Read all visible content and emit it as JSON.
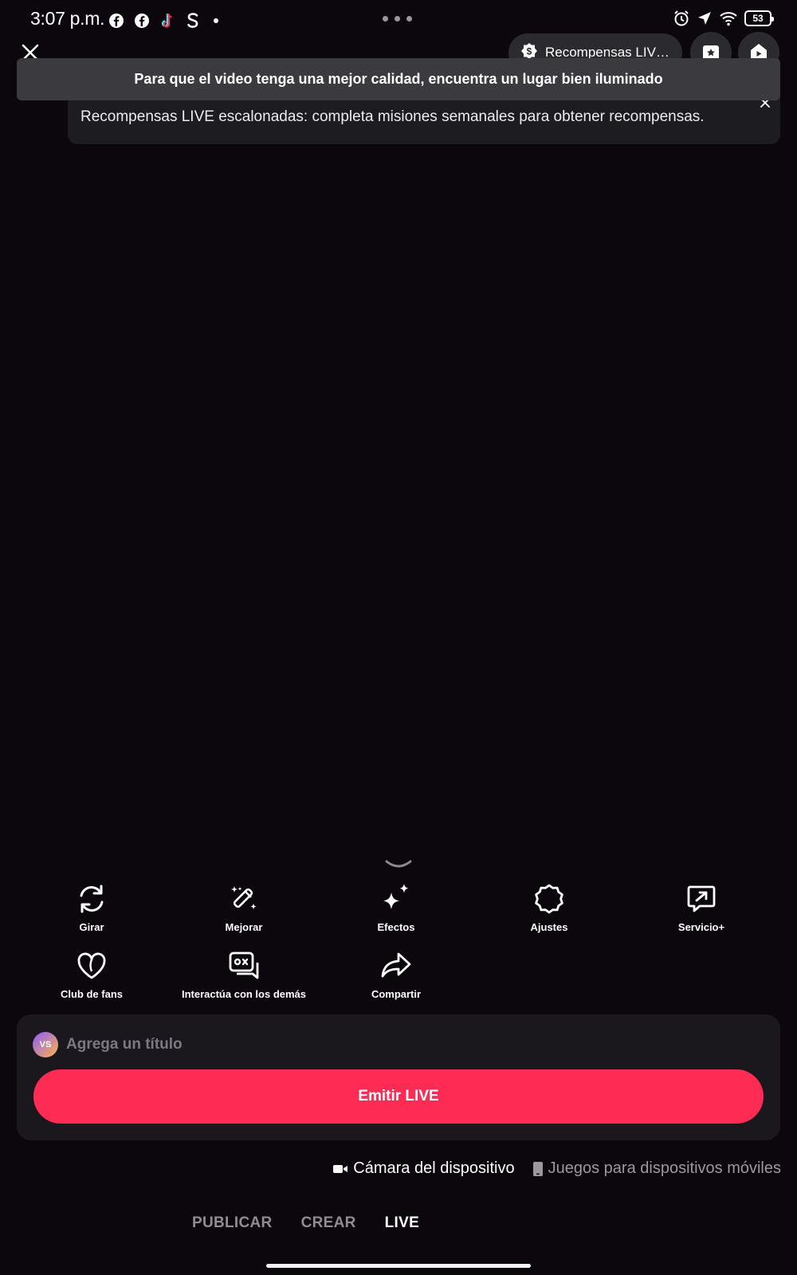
{
  "status_bar": {
    "time": "3:07 p.m.",
    "notification_icons": [
      "facebook-icon",
      "facebook-icon",
      "tiktok-icon",
      "s-app-icon"
    ],
    "battery": "53"
  },
  "top_bar": {
    "rewards_label": "Recompensas LIVE..."
  },
  "toast": {
    "message": "Para que el video tenga una mejor calidad, encuentra un lugar bien iluminado"
  },
  "tip": {
    "message": "Recompensas LIVE escalonadas: completa misiones semanales para obtener recompensas."
  },
  "tools": [
    {
      "label": "Girar",
      "icon": "rotate-icon"
    },
    {
      "label": "Mejorar",
      "icon": "magic-wand-icon"
    },
    {
      "label": "Efectos",
      "icon": "sparkles-icon"
    },
    {
      "label": "Ajustes",
      "icon": "settings-icon"
    },
    {
      "label": "Servicio+",
      "icon": "service-icon"
    },
    {
      "label": "Club de fans",
      "icon": "heart-icon"
    },
    {
      "label": "Interactúa con los demás",
      "icon": "interact-icon"
    },
    {
      "label": "Compartir",
      "icon": "share-icon"
    }
  ],
  "panel": {
    "avatar_text": "VS",
    "title_placeholder": "Agrega un título",
    "go_live_label": "Emitir LIVE"
  },
  "sources": {
    "camera": "Cámara del dispositivo",
    "mobile_games": "Juegos para dispositivos móviles"
  },
  "modes": {
    "publish": "PUBLICAR",
    "create": "CREAR",
    "live": "LIVE"
  },
  "colors": {
    "background": "#0b070c",
    "accent": "#fe2c55"
  }
}
